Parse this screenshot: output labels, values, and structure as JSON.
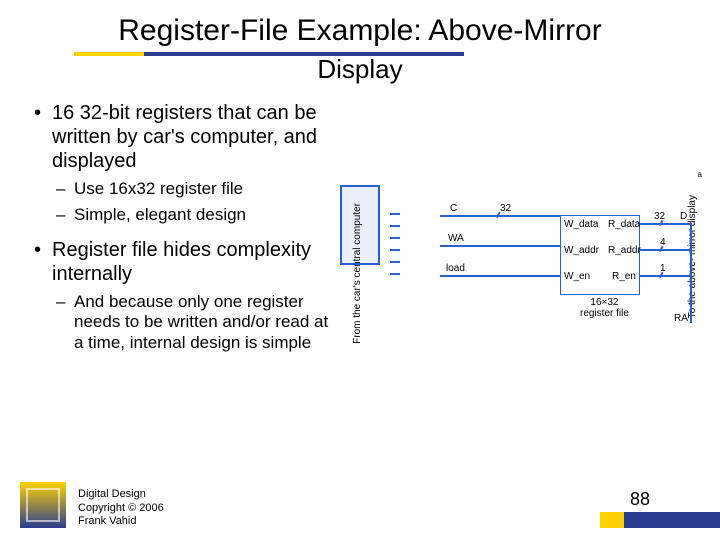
{
  "title_main": "Register-File Example:",
  "title_tail": " Above-Mirror",
  "subtitle": "Display",
  "bullets": {
    "b1": "16 32-bit registers that can be written by car's computer, and displayed",
    "s1a": "Use 16x32 register file",
    "s1b": "Simple, elegant design",
    "b2": "Register file hides complexity internally",
    "s2a": "And because only one register needs to be written and/or read at a time, internal design is simple"
  },
  "diagram": {
    "src_label": "From the car's\ncentral computer",
    "dst_label": "To the above-\nmirror display",
    "sig_C": "C",
    "sig_32a": "32",
    "sig_WA": "WA",
    "sig_load": "load",
    "rf_Wdata": "W_data",
    "rf_Waddr": "W_addr",
    "rf_Wen": "W_en",
    "rf_Rdata": "R_data",
    "rf_Raddr": "R_addr",
    "rf_Ren": "R_en",
    "sig_32b": "32",
    "sig_D": "D",
    "sig_4": "4",
    "sig_1": "1",
    "sig_RA": "RA",
    "rf_caption": "16×32\nregister file"
  },
  "tiny": "a",
  "credit_l1": "Digital Design",
  "credit_l2": "Copyright © 2006",
  "credit_l3": "Frank Vahid",
  "page": "88"
}
